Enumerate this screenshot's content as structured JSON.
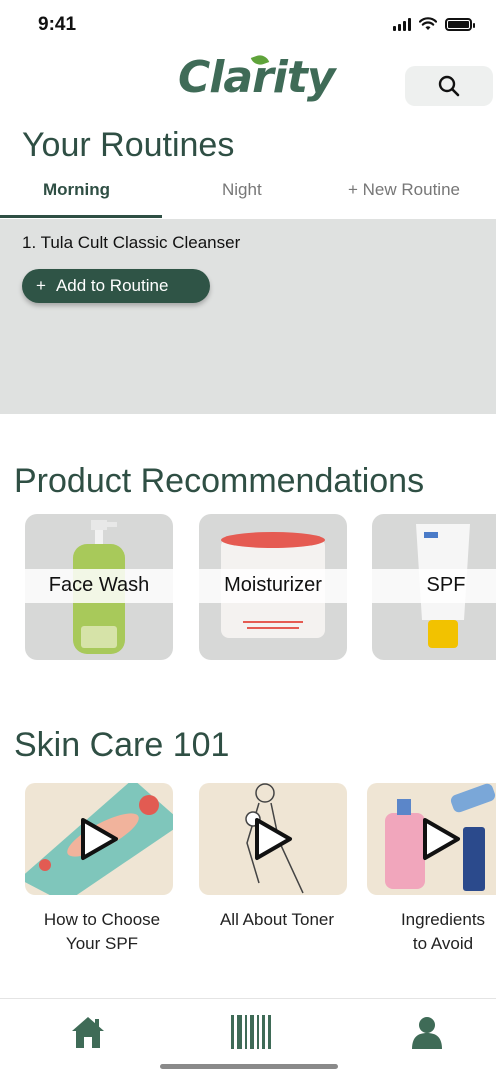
{
  "status_bar": {
    "time": "9:41"
  },
  "header": {
    "logo_text": "Clarity",
    "search_icon": "search-icon"
  },
  "routines": {
    "title": "Your Routines",
    "tabs": [
      {
        "label": "Morning",
        "active": true
      },
      {
        "label": "Night",
        "active": false
      },
      {
        "label": "+ New Routine",
        "active": false
      }
    ],
    "items": [
      "1. Tula Cult Classic Cleanser"
    ],
    "add_button": {
      "icon": "+",
      "label": "Add to Routine"
    }
  },
  "recommendations": {
    "title": "Product Recommendations",
    "products": [
      {
        "label": "Face Wash"
      },
      {
        "label": "Moisturizer"
      },
      {
        "label": "SPF"
      }
    ]
  },
  "skincare": {
    "title": "Skin Care 101",
    "videos": [
      {
        "caption_line1": "How to Choose",
        "caption_line2": "Your SPF"
      },
      {
        "caption_line1": "All About Toner",
        "caption_line2": ""
      },
      {
        "caption_line1": "Ingredients",
        "caption_line2": "to Avoid"
      }
    ]
  },
  "bottom_nav": {
    "items": [
      {
        "icon": "home-icon"
      },
      {
        "icon": "barcode-icon"
      },
      {
        "icon": "profile-icon"
      }
    ]
  },
  "colors": {
    "brand": "#3f6b57",
    "primary_dark": "#2f5446",
    "panel_bg": "#dfe1e0",
    "card_bg": "#d7d8d7",
    "video_bg": "#efe5d4"
  }
}
